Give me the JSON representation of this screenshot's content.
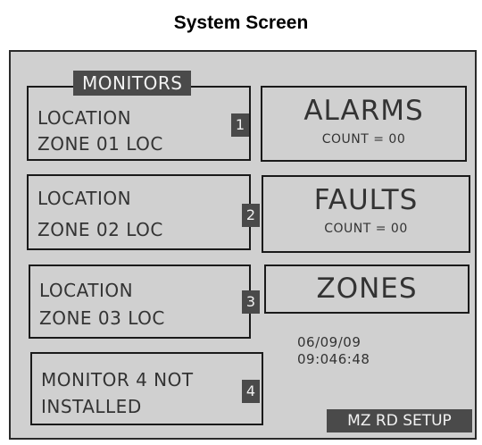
{
  "title": "System Screen",
  "monitors_header": "MONITORS",
  "monitors": [
    {
      "number": "1",
      "line1": "LOCATION",
      "line2": "ZONE  01  LOC"
    },
    {
      "number": "2",
      "line1": "LOCATION",
      "line2": "ZONE 02  LOC"
    },
    {
      "number": "3",
      "line1": "LOCATION",
      "line2": "ZONE 03  LOC"
    },
    {
      "number": "4",
      "line1": "MONITOR 4 NOT",
      "line2": "INSTALLED"
    }
  ],
  "alarms": {
    "label": "ALARMS",
    "count": "COUNT = 00"
  },
  "faults": {
    "label": "FAULTS",
    "count": "COUNT = 00"
  },
  "zones": {
    "label": "ZONES"
  },
  "date": "06/09/09",
  "time": "09:046:48",
  "setup_button": "MZ RD SETUP",
  "colors": {
    "panel_bg": "#d0d0d0",
    "badge_bg": "#4a4a4a",
    "border": "#1a1a1a"
  }
}
